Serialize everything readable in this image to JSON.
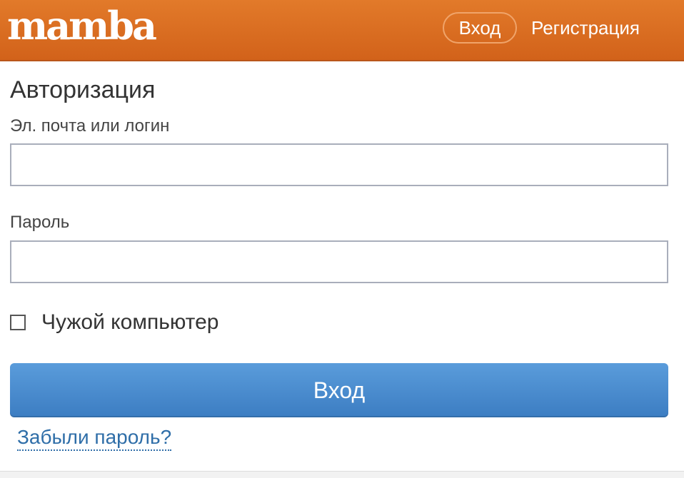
{
  "header": {
    "logo": "mamba",
    "login_label": "Вход",
    "register_label": "Регистрация",
    "color": "#d9691f"
  },
  "form": {
    "title": "Авторизация",
    "login_label": "Эл. почта или логин",
    "login_value": "",
    "password_label": "Пароль",
    "password_value": "",
    "remember_label": "Чужой компьютер",
    "remember_checked": false,
    "submit_label": "Вход",
    "submit_color": "#4a8bd0",
    "forgot_label": "Забыли пароль?"
  }
}
